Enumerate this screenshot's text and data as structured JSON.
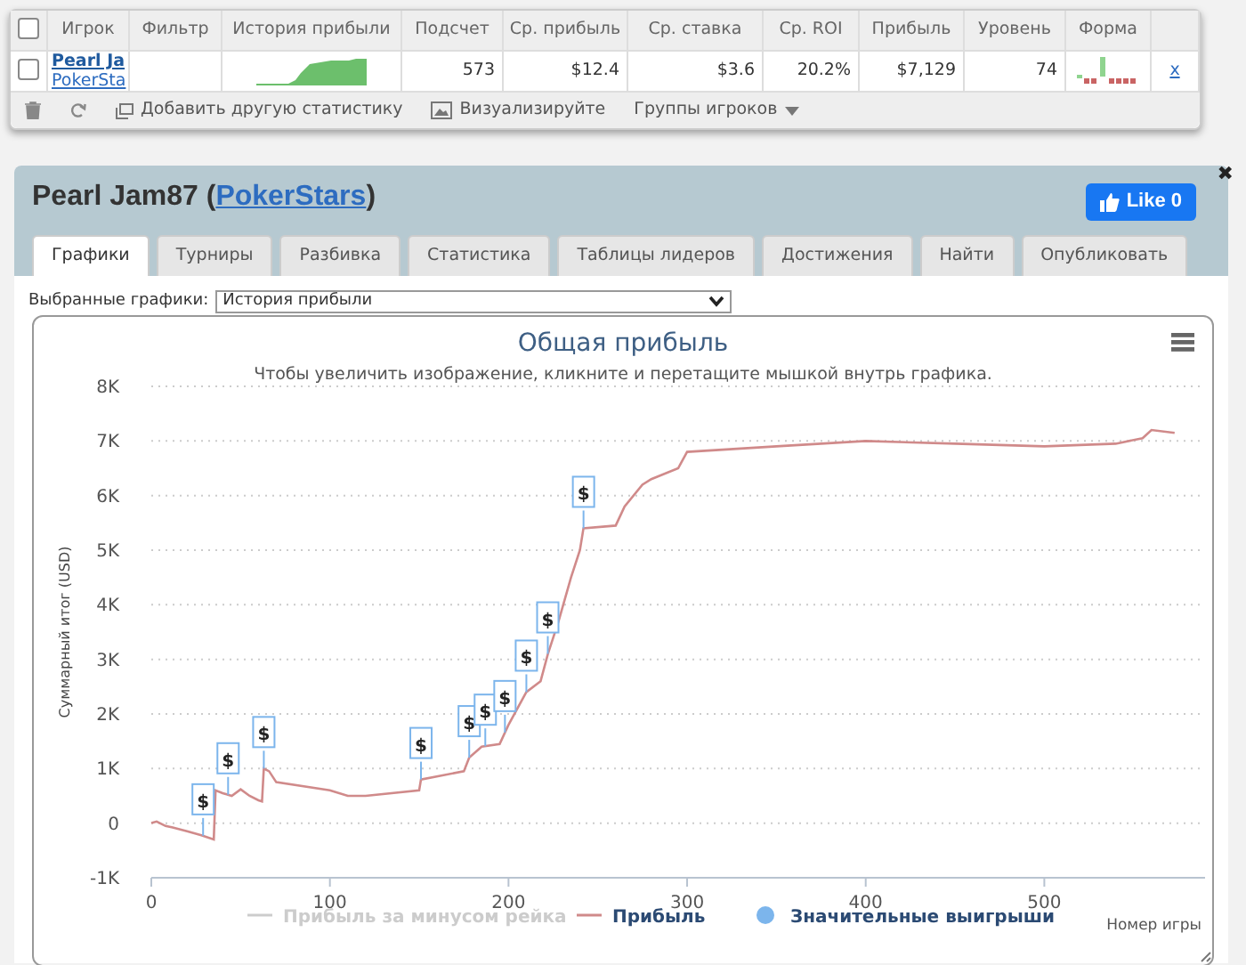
{
  "stats_table": {
    "header_checked": false,
    "columns": [
      "Игрок",
      "Фильтр",
      "История прибыли",
      "Подсчет",
      "Ср. прибыль",
      "Ср. ставка",
      "Ср. ROI",
      "Прибыль",
      "Уровень",
      "Форма"
    ],
    "rows": [
      {
        "checked": false,
        "cells": [
          {
            "kind": "player",
            "name": "Pearl Ja",
            "site": "PokerSta"
          },
          {
            "kind": "empty"
          },
          {
            "kind": "picture"
          },
          {
            "kind": "text",
            "text": "573"
          },
          {
            "kind": "text",
            "text": "$12.4"
          },
          {
            "kind": "text",
            "text": "$3.6"
          },
          {
            "kind": "text",
            "text": "20.2%"
          },
          {
            "kind": "text",
            "text": "$7,129"
          },
          {
            "kind": "text",
            "text": "74"
          },
          {
            "kind": "picture"
          }
        ],
        "remove": "x"
      }
    ],
    "toolbar": [
      {
        "kind": "add",
        "label": "Добавить другую статистику"
      },
      {
        "kind": "visualize",
        "label": "Визуализируйте"
      },
      {
        "kind": "dropdown",
        "label": "Группы игроков"
      }
    ]
  },
  "panel": {
    "player": "Pearl Jam87",
    "open_paren": "(",
    "site": "PokerStars",
    "close_paren": ")",
    "like_button": "Like 0",
    "close": "✖",
    "tabs": [
      {
        "label": "Графики",
        "selected": true
      },
      {
        "label": "Турниры",
        "selected": false
      },
      {
        "label": "Разбивка",
        "selected": false
      },
      {
        "label": "Статистика",
        "selected": false
      },
      {
        "label": "Таблицы лидеров",
        "selected": false
      },
      {
        "label": "Достижения",
        "selected": false
      },
      {
        "label": "Найти",
        "selected": false
      },
      {
        "label": "Опубликовать",
        "selected": false
      }
    ],
    "chart_selector": {
      "label": "Выбранные графики:",
      "value": "История прибыли"
    },
    "chart": {
      "subtitle": "Чтобы увеличить изображение, кликните и перетащите мышкой внутрь графика.",
      "legend": [
        {
          "label": "Прибыль за минусом рейка",
          "kind": "line",
          "enabled": false
        },
        {
          "kind": "series",
          "enabled": true
        },
        {
          "label": "Значительные выигрыши",
          "kind": "dot",
          "enabled": true
        }
      ],
      "chart_data": {
        "type": "line",
        "title": "Общая прибыль",
        "xlabel": "Номер игры",
        "ylabel": "Суммарный итог (USD)",
        "x": [
          0,
          3,
          8,
          12,
          20,
          28,
          35,
          36,
          40,
          45,
          50,
          55,
          60,
          62,
          63,
          66,
          70,
          100,
          110,
          120,
          150,
          151,
          175,
          178,
          185,
          195,
          200,
          210,
          218,
          222,
          228,
          235,
          240,
          242,
          260,
          265,
          275,
          280,
          295,
          300,
          350,
          400,
          450,
          500,
          540,
          555,
          560,
          573
        ],
        "series": [
          {
            "name": "Прибыль",
            "color": "#d08a8a",
            "values": [
              0,
              30,
              -50,
              -80,
              -150,
              -220,
              -300,
              600,
              550,
              500,
              620,
              500,
              420,
              400,
              1000,
              950,
              750,
              600,
              500,
              500,
              600,
              800,
              950,
              1200,
              1400,
              1450,
              1800,
              2400,
              2600,
              3100,
              3700,
              4500,
              5000,
              5400,
              5450,
              5800,
              6200,
              6300,
              6500,
              6800,
              6900,
              7000,
              6950,
              6900,
              6950,
              7050,
              7200,
              7150
            ]
          }
        ],
        "xlim": [
          0,
          590
        ],
        "ylim": [
          -1000,
          8000
        ],
        "grid": true,
        "xticks": [
          0,
          100,
          200,
          300,
          400,
          500
        ],
        "yticks": [
          {
            "value": -1000,
            "label": "-1K"
          },
          {
            "value": 0,
            "label": "0"
          },
          {
            "value": 1000,
            "label": "1K"
          },
          {
            "value": 2000,
            "label": "2K"
          },
          {
            "value": 3000,
            "label": "3K"
          },
          {
            "value": 4000,
            "label": "4K"
          },
          {
            "value": 5000,
            "label": "5K"
          },
          {
            "value": 6000,
            "label": "6K"
          },
          {
            "value": 7000,
            "label": "7K"
          },
          {
            "value": 8000,
            "label": "8K"
          }
        ],
        "annotations": [
          {
            "x": 29,
            "text": "$"
          },
          {
            "x": 43,
            "text": "$"
          },
          {
            "x": 63,
            "text": "$"
          },
          {
            "x": 151,
            "text": "$"
          },
          {
            "x": 178,
            "text": "$"
          },
          {
            "x": 187,
            "text": "$"
          },
          {
            "x": 198,
            "text": "$"
          },
          {
            "x": 210,
            "text": "$"
          },
          {
            "x": 222,
            "text": "$"
          },
          {
            "x": 242,
            "text": "$"
          }
        ]
      }
    }
  }
}
